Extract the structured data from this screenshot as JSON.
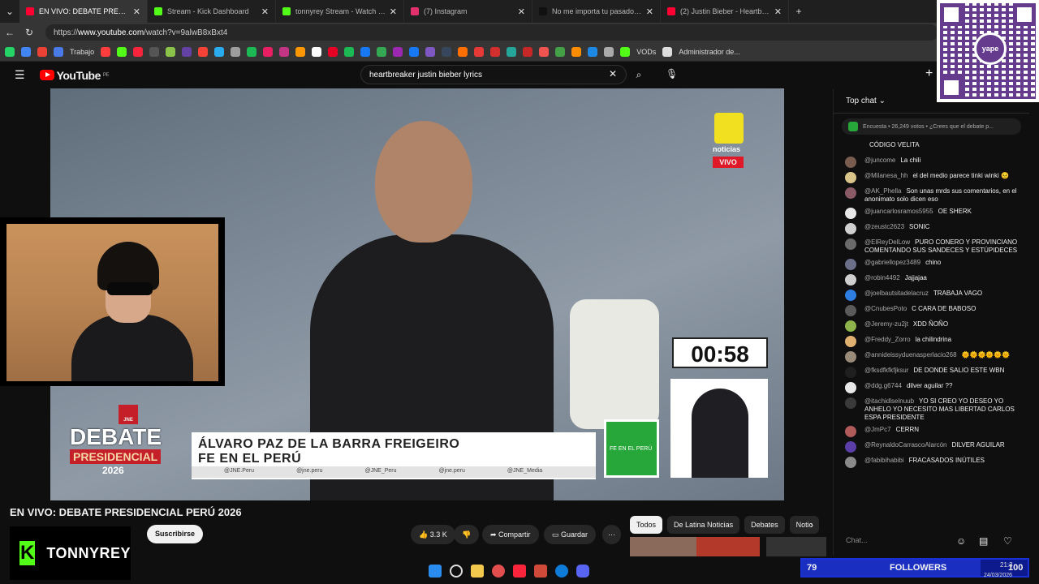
{
  "browser": {
    "tabs": [
      {
        "title": "EN VIVO: DEBATE PRESIDENCIAL",
        "active": true,
        "color": "#ff0033"
      },
      {
        "title": "Stream - Kick Dashboard",
        "active": false,
        "color": "#53fc18"
      },
      {
        "title": "tonnyrey Stream - Watch Live on K",
        "active": false,
        "color": "#53fc18"
      },
      {
        "title": "(7) Instagram",
        "active": false,
        "color": "#e1306c"
      },
      {
        "title": "No me importa tu pasado: Un me",
        "active": false,
        "color": "#111111"
      },
      {
        "title": "(2) Justin Bieber - Heartbreaker (A",
        "active": false,
        "color": "#ff0033"
      }
    ],
    "url_prefix": "https://",
    "url_host": "www.youtube.com",
    "url_path": "/watch?v=9alwB8xBxt4",
    "bookmarks": [
      "Trabajo",
      "VODs",
      "Administrador de..."
    ]
  },
  "youtube": {
    "logo": "YouTube",
    "region": "PE",
    "search_value": "heartbreaker justin bieber lyrics",
    "video_title": "EN VIVO: DEBATE PRESIDENCIAL PERÚ 2026",
    "subscribe_label": "Suscribirse",
    "likes": "3.3 K",
    "share_label": "Compartir",
    "save_label": "Guardar",
    "chips": [
      "Todos",
      "De Latina Noticias",
      "Debates",
      "Notic"
    ]
  },
  "broadcast": {
    "channel_brand": "noticias",
    "live_badge": "VIVO",
    "timer": "00:58",
    "candidate_name": "ÁLVARO PAZ DE LA BARRA FREIGEIRO",
    "party": "FE EN EL PERÚ",
    "socials": [
      "@JNE.Peru",
      "@jne.peru",
      "@JNE_Peru",
      "@jne.peru",
      "@JNE_Media"
    ],
    "debate_line1": "DEBATE",
    "debate_line2": "PRESIDENCIAL",
    "debate_year": "2026",
    "jne": "JNE",
    "party_logo_text": "FE EN EL PERÚ"
  },
  "chat": {
    "header": "Top chat",
    "poll": "Encuesta • 26,249 votos • ¿Crees que el debate p...",
    "messages": [
      {
        "user": "",
        "text": "CÓDIGO VELITA",
        "color": "#0f0f0f"
      },
      {
        "user": "@juncome",
        "text": "La chili",
        "color": "#7a5c4f"
      },
      {
        "user": "@Milanesa_hh",
        "text": "el del medio parece tinki winki 😣",
        "color": "#d9c48a"
      },
      {
        "user": "@AK_Phella",
        "text": "Son unas mrds sus comentarios, en el anonimato solo dicen eso",
        "color": "#8a5b66"
      },
      {
        "user": "@juancarlosramos5955",
        "text": "OE SHERK",
        "color": "#e8e8e8"
      },
      {
        "user": "@zeustc2623",
        "text": "SONIC",
        "color": "#d0d0d0"
      },
      {
        "user": "@ElReyDelLow",
        "text": "PURO CONERO Y PROVINCIANO COMENTANDO SUS SANDECES Y ESTÚPIDECES",
        "color": "#6a6a6a"
      },
      {
        "user": "@gabriellopez3489",
        "text": "chino",
        "color": "#6b6f87"
      },
      {
        "user": "@robin4492",
        "text": "Jajjajaa",
        "color": "#cfcfcf"
      },
      {
        "user": "@joelbautsitadelacruz",
        "text": "TRABAJA VAGO",
        "color": "#2e7de0"
      },
      {
        "user": "@CnubesPoto",
        "text": "C CARA DE BABOSO",
        "color": "#5a5a5a"
      },
      {
        "user": "@Jeremy-zu2jt",
        "text": "XDD ÑOÑO",
        "color": "#8db34a"
      },
      {
        "user": "@Freddy_Zorro",
        "text": "la chilindrina",
        "color": "#e0b070"
      },
      {
        "user": "@annideissyduenasperlacio268",
        "text": "🌞🌞🌞🌞🌞🌞",
        "color": "#9a8a7a"
      },
      {
        "user": "@fksdfkfkfjksur",
        "text": "DE DONDE SALIO ESTE WBN",
        "color": "#1f1f1f"
      },
      {
        "user": "@ddg.g6744",
        "text": "dilver aguilar ??",
        "color": "#e8e8e8"
      },
      {
        "user": "@itachidlselnuub",
        "text": "YO SI CREO YO DESEO YO ANHELO YO NECESITO MAS LIBERTAD CARLOS ESPA PRESIDENTE",
        "color": "#3a3a3a"
      },
      {
        "user": "@JmPc7",
        "text": "CERRN",
        "color": "#b05a5a"
      },
      {
        "user": "@ReynaldoCarrascoAlarcón",
        "text": "DILVER AGUILAR",
        "color": "#5b3ea8"
      },
      {
        "user": "@fabibihabibi",
        "text": "FRACASADOS INÚTILES",
        "color": "#8a8a8a"
      }
    ],
    "input_placeholder": "Chat..."
  },
  "overlay": {
    "kick_name": "TONNYREY",
    "followers_count": "79",
    "followers_label": "FOLLOWERS",
    "followers_goal": "100",
    "yape": "yape"
  },
  "system": {
    "time": "21:3",
    "date": "24/03/2026"
  }
}
